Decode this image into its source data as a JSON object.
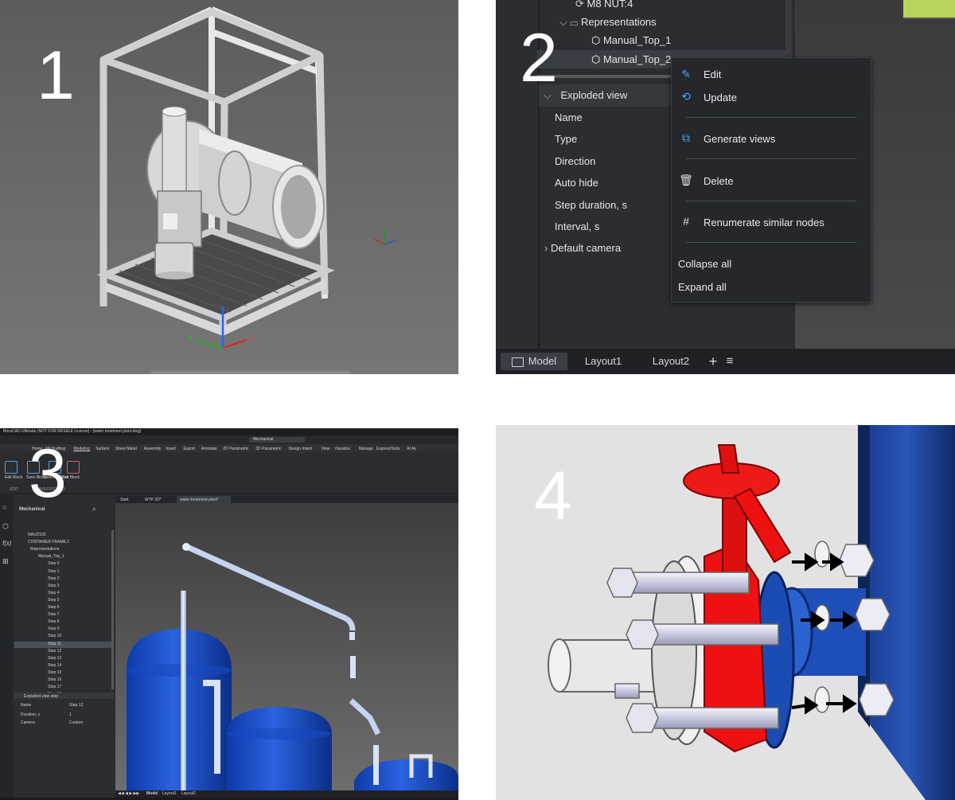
{
  "panel_labels": [
    "1",
    "2",
    "3",
    "4"
  ],
  "panel2": {
    "tree_rows": [
      "M8 NUT:4",
      "Representations",
      "Manual_Top_1",
      "Manual_Top_2"
    ],
    "section_header": "Exploded view",
    "properties": [
      "Name",
      "Type",
      "Direction",
      "Auto hide",
      "Step duration, s",
      "Interval, s",
      "Default camera"
    ],
    "context_menu": {
      "edit": "Edit",
      "update": "Update",
      "generate_views": "Generate views",
      "delete": "Delete",
      "renumerate": "Renumerate similar nodes",
      "collapse_all": "Collapse all",
      "expand_all": "Expand all"
    },
    "tabs": [
      "Model",
      "Layout1",
      "Layout2"
    ]
  },
  "panel3": {
    "title_bar": "BricsCAD Ultimate (NOT FOR RESALE License) - [water treatment plant.dwg]",
    "workspace": "Mechanical",
    "ribbon_tabs": [
      "Home",
      "2D Drafting",
      "Modeling",
      "Surface",
      "Sheet Metal",
      "Assembly",
      "Insert",
      "Export",
      "Annotate",
      "2D Parametric",
      "3D Parametric",
      "Design Intent",
      "View",
      "Visualize",
      "Manage",
      "ExpressTools",
      "AI As"
    ],
    "ribbon_buttons": [
      "Edit Block",
      "Save Block",
      "Save As Block",
      "Exit Block"
    ],
    "ribbon_groups": [
      "EDIT",
      "SAVE/DISCARD"
    ],
    "doc_tabs": [
      "Start",
      "WTP 2D*",
      "water treatment plant*"
    ],
    "browser_title": "Mechanical",
    "tree": [
      "NAUD103",
      "CONTAINER FRAME:1",
      "Representations",
      "Manual_Top_1",
      "Step 0",
      "Step 1",
      "Step 2",
      "Step 3",
      "Step 4",
      "Step 5",
      "Step 6",
      "Step 7",
      "Step 8",
      "Step 9",
      "Step 10",
      "Step 11",
      "Step 12",
      "Step 13",
      "Step 14",
      "Step 15",
      "Step 16",
      "Step 17",
      "Step 18"
    ],
    "selected_step": "Step 12",
    "props_header": "Exploded view step",
    "props": [
      {
        "label": "Name",
        "value": "Step 12"
      },
      {
        "label": "Duration, s",
        "value": "1"
      },
      {
        "label": "Camera",
        "value": "Custom"
      }
    ],
    "bottom_tabs": [
      "Model",
      "Layout1",
      "Layout2"
    ]
  },
  "colors": {
    "dark_bg": "#2b2d31",
    "menu_bg": "#25272b",
    "accent": "#4aa3ff",
    "pipe_blue": "#1f4fbf",
    "valve_red": "#ee1111"
  }
}
